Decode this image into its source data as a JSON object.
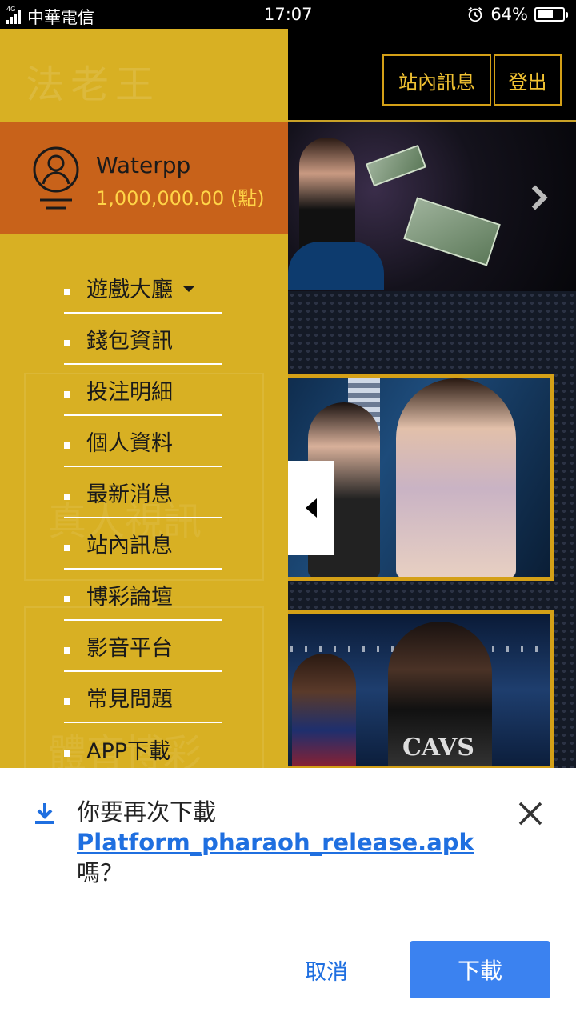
{
  "status_bar": {
    "network": "4G",
    "carrier": "中華電信",
    "time": "17:07",
    "battery_percent": "64%",
    "battery_level": 0.64
  },
  "header": {
    "logo_text": "法老王",
    "messages_button": "站內訊息",
    "logout_button": "登出"
  },
  "banner": {
    "card_text": "CAVS"
  },
  "drawer": {
    "user": {
      "name": "Waterpp",
      "balance": "1,000,000.00 (點)"
    },
    "menu": [
      {
        "label": "遊戲大廳",
        "has_dropdown": true
      },
      {
        "label": "錢包資訊"
      },
      {
        "label": "投注明細"
      },
      {
        "label": "個人資料"
      },
      {
        "label": "最新消息"
      },
      {
        "label": "站內訊息"
      },
      {
        "label": "博彩論壇"
      },
      {
        "label": "影音平台"
      },
      {
        "label": "常見問題"
      },
      {
        "label": "APP下載"
      }
    ],
    "background_labels": [
      "真人視訊",
      "體育博彩"
    ]
  },
  "download_sheet": {
    "message_prefix": "你要再次下載",
    "filename": "Platform_pharaoh_release.apk",
    "message_suffix": "嗎？",
    "cancel_button": "取消",
    "download_button": "下載"
  },
  "colors": {
    "drawer_bg": "#d8b023",
    "user_panel_bg": "#c8621a",
    "balance_text": "#ffd447",
    "gold_border": "#d4a017",
    "link_blue": "#1f6fe0",
    "primary_button": "#3b82f0"
  },
  "icons": {
    "user_avatar": "user-circle-icon",
    "dropdown": "caret-down-icon",
    "banner_next": "chevron-right-icon",
    "drawer_toggle": "triangle-left-icon",
    "download": "download-icon",
    "close": "close-icon",
    "alarm": "alarm-clock-icon"
  }
}
